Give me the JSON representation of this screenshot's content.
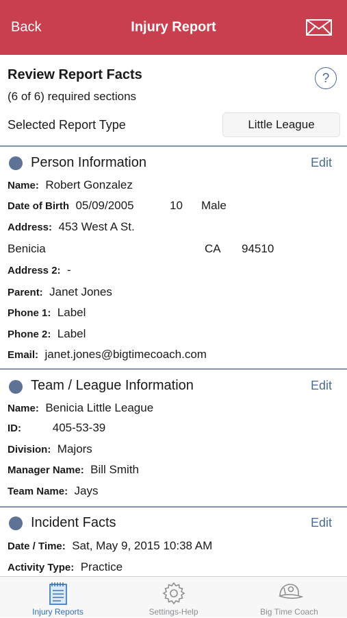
{
  "nav": {
    "back": "Back",
    "title": "Injury Report"
  },
  "review": {
    "title": "Review Report Facts",
    "subtitle": "(6 of 6) required sections",
    "help": "?",
    "report_type_label": "Selected Report Type",
    "report_type_value": "Little League"
  },
  "person": {
    "title": "Person Information",
    "edit": "Edit",
    "name_label": "Name:",
    "name": "Robert Gonzalez",
    "dob_label": "Date of Birth",
    "dob": "05/09/2005",
    "age": "10",
    "gender": "Male",
    "address_label": "Address:",
    "address": "453 West A St.",
    "city": "Benicia",
    "state": "CA",
    "zip": "94510",
    "address2_label": "Address 2:",
    "address2": "-",
    "parent_label": "Parent:",
    "parent": "Janet Jones",
    "phone1_label": "Phone 1:",
    "phone1": "Label",
    "phone2_label": "Phone 2:",
    "phone2": "Label",
    "email_label": "Email:",
    "email": "janet.jones@bigtimecoach.com"
  },
  "team": {
    "title": "Team / League Information",
    "edit": "Edit",
    "name_label": "Name:",
    "name": "Benicia Little League",
    "id_label": "ID:",
    "id": "405-53-39",
    "division_label": "Division:",
    "division": "Majors",
    "manager_label": "Manager Name:",
    "manager": "Bill Smith",
    "team_label": "Team Name:",
    "team": "Jays"
  },
  "incident": {
    "title": "Incident Facts",
    "edit": "Edit",
    "datetime_label": "Date / Time:",
    "datetime": "Sat, May 9, 2015 10:38 AM",
    "activity_label": "Activity Type:",
    "activity": "Practice"
  },
  "tabs": [
    {
      "label": "Injury Reports",
      "icon": "notepad-icon",
      "active": true
    },
    {
      "label": "Settings-Help",
      "icon": "gear-icon",
      "active": false
    },
    {
      "label": "Big Time Coach",
      "icon": "cap-icon",
      "active": false
    }
  ],
  "colors": {
    "nav": "#c8404f",
    "accent": "#4a6b9a",
    "tab_active": "#2f6fb5",
    "dot": "#5d7294"
  }
}
